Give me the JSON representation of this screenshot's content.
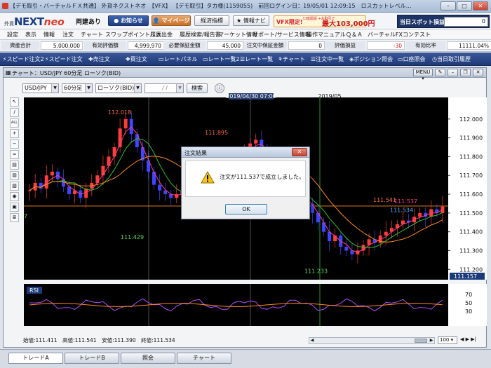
{
  "window": {
    "title": "【デモ取引・バーチャルＦＸ共通】 外貨ネクストネオ　【VFX】 【デモ取引】タカ様(1159055)　前回ログイン日：19/05/01 12:09:15　ロスカットレベル…",
    "min": "–",
    "max": "□",
    "close": "✕"
  },
  "brand": {
    "logo_prefix": "外貨",
    "logo_main": "NEXT",
    "logo_neo": "neo",
    "mode": "両建あり",
    "notice_button": "お知らせ",
    "mypage_button": "マイページ",
    "indicator_button": "経済指標",
    "info_button": "情報ナビ",
    "promo_a": "VFX限定!",
    "promo_b": "口座開設 +お取引で",
    "promo_c": "最大103,000円",
    "pnl_label": "当日スポット損益",
    "pnl_value": "0"
  },
  "menu": [
    "設定",
    "表示",
    "情報",
    "注文",
    "チャート",
    "スワップポイント履歴",
    "入出金",
    "履歴検索/報告書",
    "マーケット情報",
    "サポート/サービス情報",
    "操作マニュアル",
    "Ｑ＆Ａ",
    "バーチャルFXコンテスト"
  ],
  "account": {
    "items": [
      {
        "label": "資産合計",
        "value": "5,000,000"
      },
      {
        "label": "有効評価額",
        "value": "4,999,970"
      },
      {
        "label": "必要保証金額",
        "value": "45,000"
      },
      {
        "label": "注文中保証金額",
        "value": "0"
      },
      {
        "label": "評価損益",
        "value": "-30"
      },
      {
        "label": "有効比率",
        "value": "11111.04%"
      }
    ]
  },
  "toolbar": [
    "スピード注文2",
    "スピード注文",
    "売注文",
    "買注文",
    "レートパネル",
    "レート一覧2",
    "レート一覧",
    "チャート",
    "注文中一覧",
    "ポジション照会",
    "口座照会",
    "当日取引履歴"
  ],
  "chart_window": {
    "title": "チャート：USD/JPY 60分足 ローソク(BID)",
    "menu_button": "MENU ▾",
    "pair": "USD/JPY",
    "timeframe": "60分足",
    "chart_type": "ローソク(BID)",
    "date_placeholder": "/ /",
    "search_button": "検索",
    "info_icon": "ⓘ",
    "ohlc": "始値:111.411　高値:111.541　安値:111.390　終値:111.534",
    "zoom": "100"
  },
  "chart_data": {
    "type": "candlestick",
    "pair": "USD/JPY",
    "timeframe": "60分足",
    "price_axis": [
      112.0,
      111.9,
      111.8,
      111.7,
      111.6,
      111.5,
      111.4,
      111.3,
      111.2
    ],
    "price_axis_labels": [
      "112.000",
      "111.900",
      "111.800",
      "111.700",
      "111.600",
      "111.500",
      "111.400",
      "111.300",
      "111.200"
    ],
    "ylim": [
      111.145,
      112.115
    ],
    "current_price": "111.157",
    "date_labels": [
      "2019/04/30 07:00",
      "2019/05"
    ],
    "annotations": [
      {
        "text": "112.018",
        "price": 112.018,
        "color": "#ff6a3c"
      },
      {
        "text": "111.895",
        "price": 111.895,
        "color": "#ff6a3c"
      },
      {
        "text": "111.429",
        "price": 111.429,
        "color": "#5cd65c"
      },
      {
        "text": "111.233",
        "price": 111.233,
        "color": "#5cd65c"
      },
      {
        "text": "111.541",
        "price": 111.541,
        "color": "#ff6a3c"
      },
      {
        "text": "111.537",
        "price": 111.537,
        "color": "#ff3c8c"
      },
      {
        "text": "111.534",
        "price": 111.534,
        "color": "#5aaaff"
      },
      {
        "text": "7",
        "price": 111.45,
        "color": "#5cd65c"
      }
    ],
    "hline_price": 111.537,
    "closes": [
      111.62,
      111.66,
      111.63,
      111.7,
      111.72,
      111.68,
      111.64,
      111.6,
      111.62,
      111.58,
      111.63,
      111.66,
      111.7,
      111.75,
      111.8,
      111.85,
      111.95,
      112.0,
      111.92,
      111.85,
      111.78,
      111.72,
      111.65,
      111.62,
      111.6,
      111.58,
      111.6,
      111.62,
      111.64,
      111.6,
      111.63,
      111.65,
      111.61,
      111.6,
      111.62,
      111.66,
      111.7,
      111.75,
      111.82,
      111.87,
      111.89,
      111.84,
      111.78,
      111.72,
      111.66,
      111.62,
      111.58,
      111.6,
      111.58,
      111.55,
      111.5,
      111.45,
      111.4,
      111.35,
      111.38,
      111.32,
      111.3,
      111.28,
      111.3,
      111.33,
      111.36,
      111.34,
      111.38,
      111.4,
      111.42,
      111.44,
      111.46,
      111.45,
      111.48,
      111.5,
      111.48,
      111.52,
      111.5,
      111.534
    ],
    "rsi": {
      "label": "RSI",
      "levels": [
        "70",
        "50",
        "30"
      ]
    }
  },
  "dialog": {
    "title": "注文結果",
    "close": "✕",
    "message": "注文が111.537で成立しました。",
    "ok": "OK"
  },
  "tabs": [
    "トレードA",
    "トレードB",
    "照会",
    "チャート"
  ],
  "colors": {
    "up": "#ff3c3c",
    "down": "#3c46ff",
    "ma_short": "#ff3c8c",
    "ma_mid": "#2fbf2f",
    "ma_long": "#ff8a1e",
    "bg": "#000000"
  }
}
